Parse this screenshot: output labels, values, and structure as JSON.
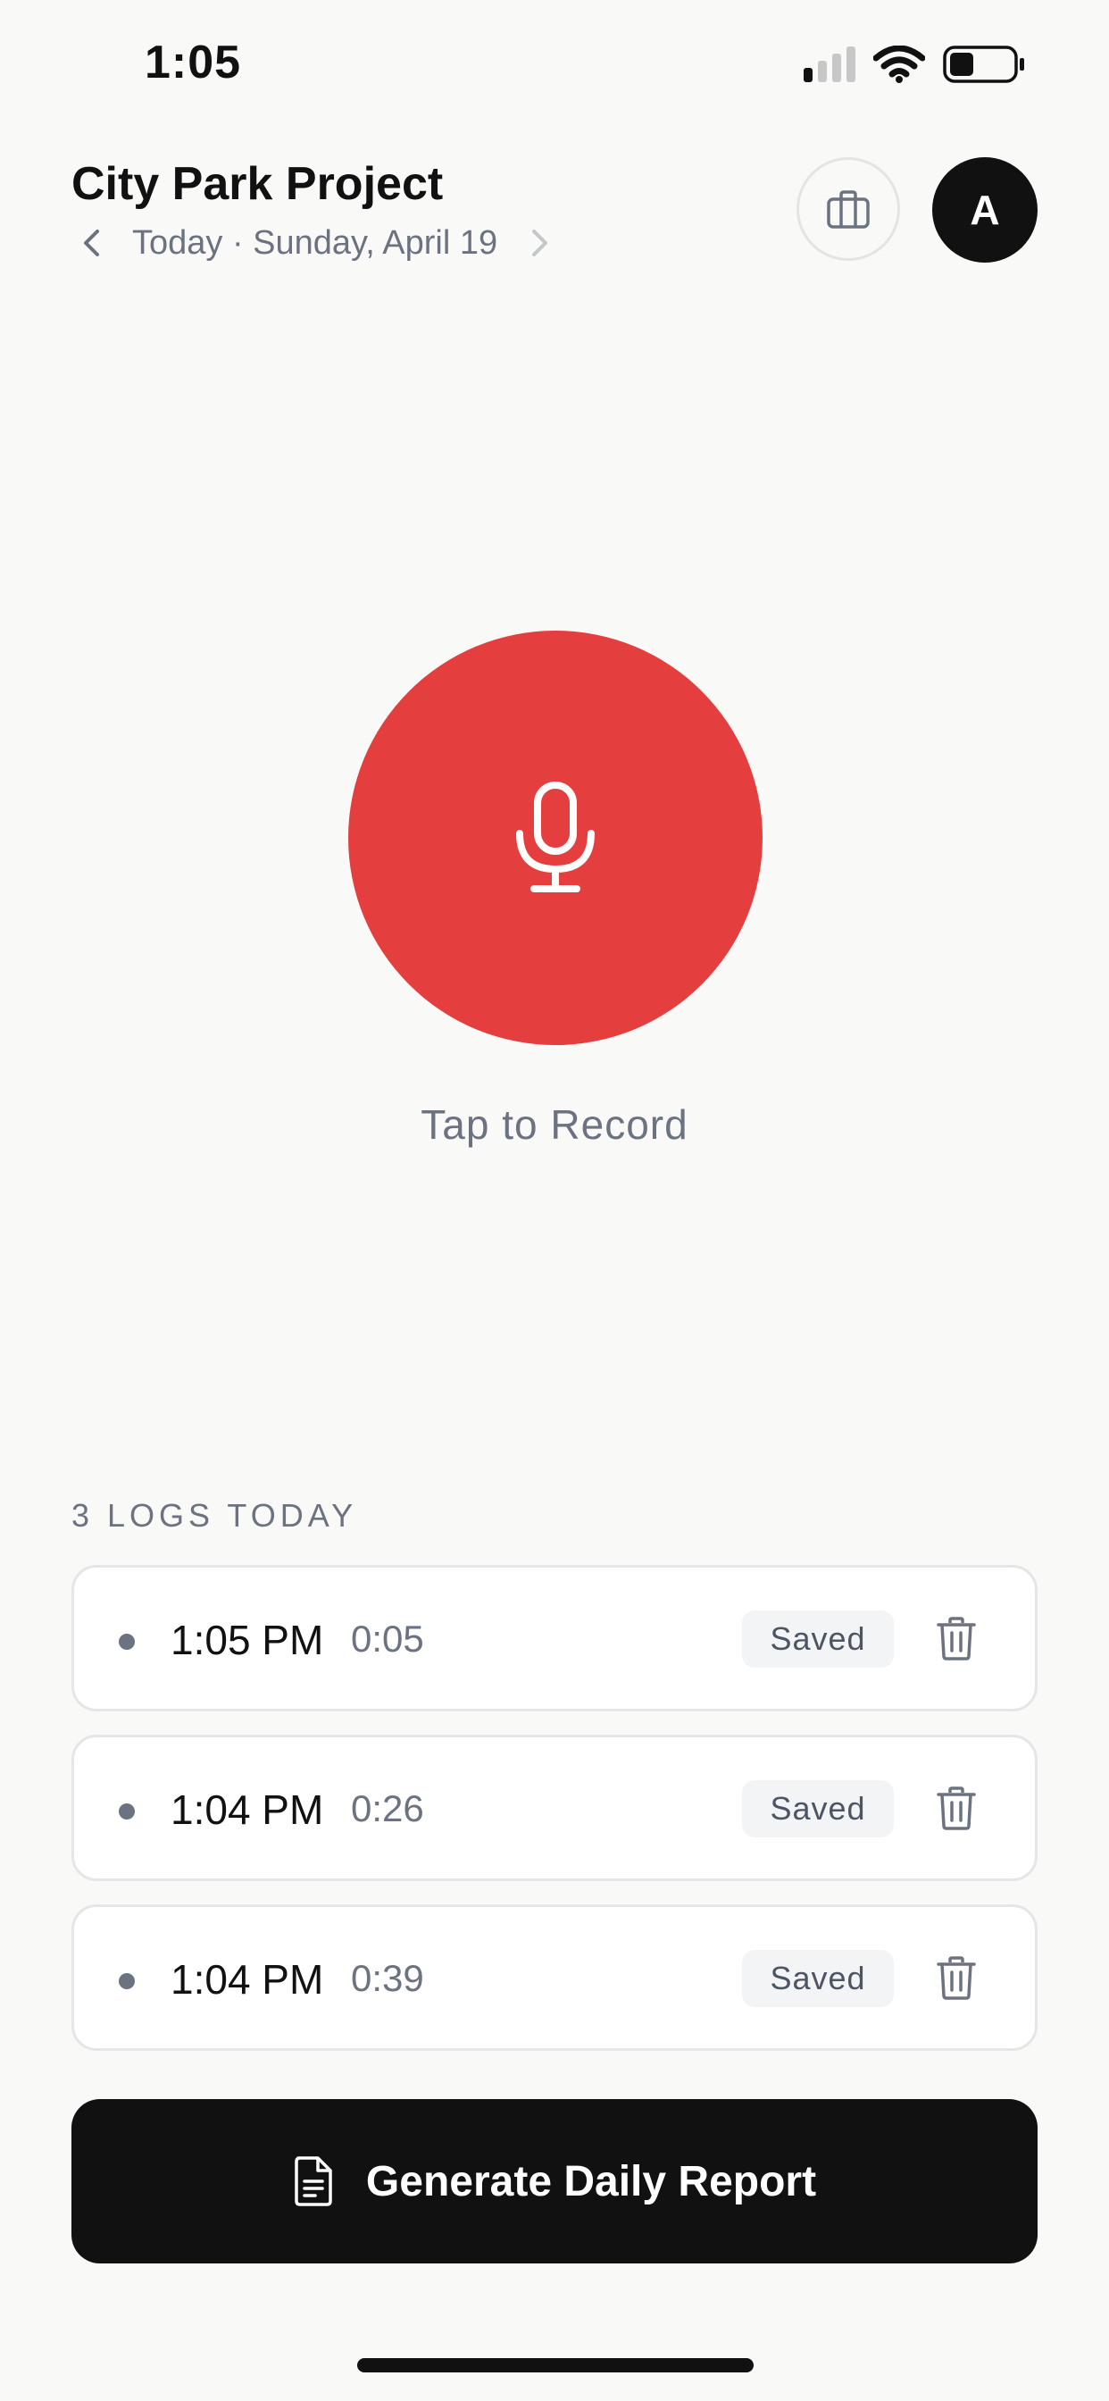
{
  "status_bar": {
    "time": "1:05",
    "icons": [
      "cellular-signal-icon",
      "wifi-icon",
      "battery-icon"
    ]
  },
  "header": {
    "project_title": "City Park Project",
    "date_label": "Today · Sunday, April 19",
    "avatar_initial": "A"
  },
  "recorder": {
    "label": "Tap to Record",
    "color": "#e53e3e"
  },
  "logs": {
    "heading": "3 LOGS TODAY",
    "items": [
      {
        "time": "1:05 PM",
        "duration": "0:05",
        "status": "Saved"
      },
      {
        "time": "1:04 PM",
        "duration": "0:26",
        "status": "Saved"
      },
      {
        "time": "1:04 PM",
        "duration": "0:39",
        "status": "Saved"
      }
    ]
  },
  "actions": {
    "generate_label": "Generate Daily Report"
  }
}
